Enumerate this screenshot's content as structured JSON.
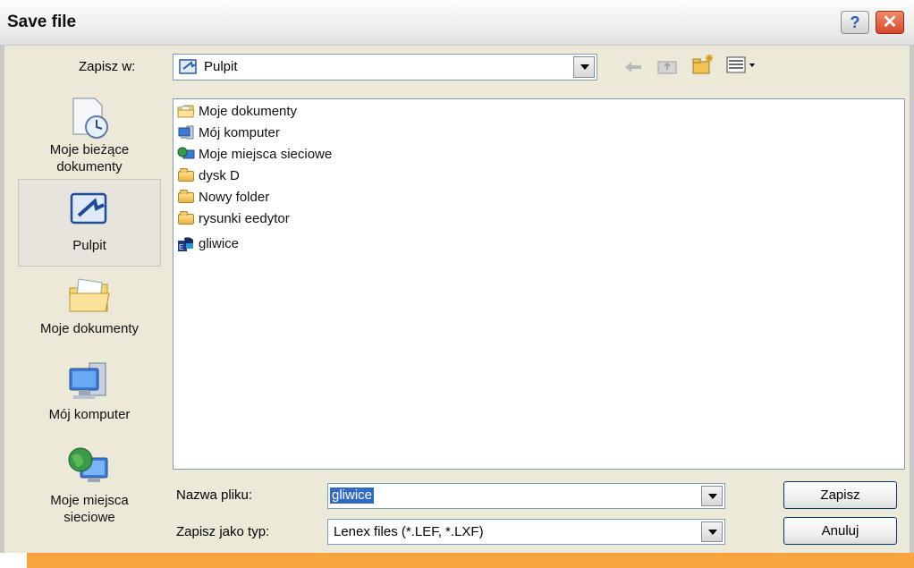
{
  "window": {
    "title": "Save file",
    "help_glyph": "?",
    "close_glyph": "✕"
  },
  "top": {
    "save_in_label": "Zapisz w:",
    "location": "Pulpit",
    "toolbar_icons": [
      "back-icon",
      "up-folder-icon",
      "new-folder-icon",
      "view-menu-icon"
    ]
  },
  "places": [
    {
      "label_line1": "Moje bieżące",
      "label_line2": "dokumenty",
      "icon": "recent-documents-icon"
    },
    {
      "label_line1": "Pulpit",
      "label_line2": "",
      "icon": "desktop-icon"
    },
    {
      "label_line1": "Moje dokumenty",
      "label_line2": "",
      "icon": "my-documents-icon"
    },
    {
      "label_line1": "Mój komputer",
      "label_line2": "",
      "icon": "my-computer-icon"
    },
    {
      "label_line1": "Moje miejsca",
      "label_line2": "sieciowe",
      "icon": "network-places-icon"
    }
  ],
  "files": [
    {
      "name": "Moje dokumenty",
      "icon": "my-documents-icon"
    },
    {
      "name": "Mój komputer",
      "icon": "my-computer-icon"
    },
    {
      "name": "Moje miejsca sieciowe",
      "icon": "network-places-icon"
    },
    {
      "name": "dysk D",
      "icon": "folder-icon"
    },
    {
      "name": "Nowy folder",
      "icon": "folder-icon"
    },
    {
      "name": "rysunki eedytor",
      "icon": "folder-icon"
    },
    {
      "name": "gliwice",
      "icon": "lenex-file-icon"
    }
  ],
  "form": {
    "filename_label": "Nazwa pliku:",
    "filename_value": "gliwice",
    "filetype_label": "Zapisz jako typ:",
    "filetype_value": "Lenex files (*.LEF, *.LXF)",
    "save_button": "Zapisz",
    "cancel_button": "Anuluj"
  },
  "colors": {
    "accent_bar": "#f7a33e",
    "selection": "#316ac5",
    "close_button": "#d64a2a"
  }
}
